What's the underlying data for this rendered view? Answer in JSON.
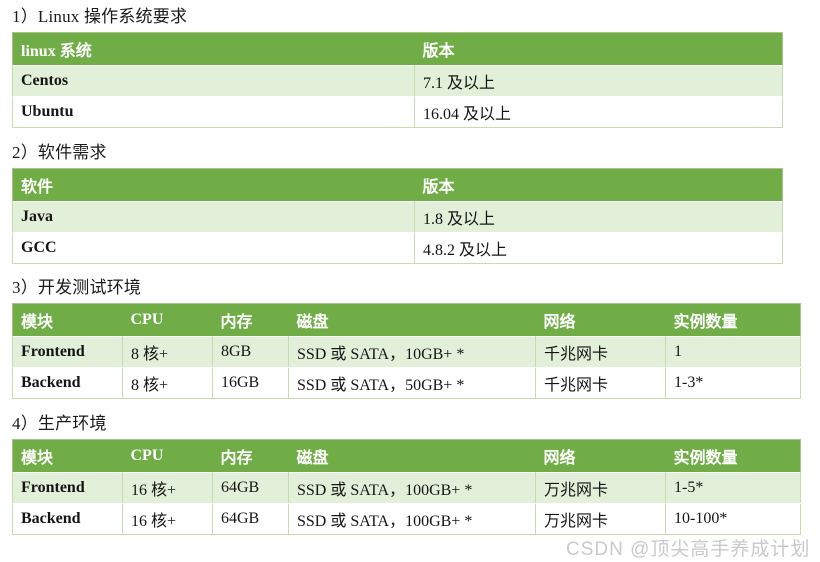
{
  "document": {
    "watermark": "CSDN @顶尖高手养成计划"
  },
  "sections": [
    {
      "title": "1）Linux 操作系统要求",
      "columns": [
        "linux 系统",
        "版本"
      ],
      "rows": [
        [
          "Centos",
          "7.1 及以上"
        ],
        [
          "Ubuntu",
          "16.04 及以上"
        ]
      ]
    },
    {
      "title": "2）软件需求",
      "columns": [
        "软件",
        "版本"
      ],
      "rows": [
        [
          "Java",
          "1.8 及以上"
        ],
        [
          "GCC",
          "4.8.2 及以上"
        ]
      ]
    },
    {
      "title": "3）开发测试环境",
      "columns": [
        "模块",
        "CPU",
        "内存",
        "磁盘",
        "网络",
        "实例数量"
      ],
      "rows": [
        [
          "Frontend",
          "8 核+",
          "8GB",
          "SSD 或 SATA，10GB+ *",
          "千兆网卡",
          "1"
        ],
        [
          "Backend",
          "8 核+",
          "16GB",
          "SSD 或 SATA，50GB+ *",
          "千兆网卡",
          "1-3*"
        ]
      ]
    },
    {
      "title": "4）生产环境",
      "columns": [
        "模块",
        "CPU",
        "内存",
        "磁盘",
        "网络",
        "实例数量"
      ],
      "rows": [
        [
          "Frontend",
          "16 核+",
          "64GB",
          "SSD 或 SATA，100GB+ *",
          "万兆网卡",
          "1-5*"
        ],
        [
          "Backend",
          "16 核+",
          "64GB",
          "SSD 或 SATA，100GB+ *",
          "万兆网卡",
          "10-100*"
        ]
      ]
    }
  ],
  "colors": {
    "header_green": "#70ad47",
    "band_light_green": "#e2efd9",
    "border_green": "#a9c48a",
    "watermark_gray": "#c9c9c9"
  }
}
